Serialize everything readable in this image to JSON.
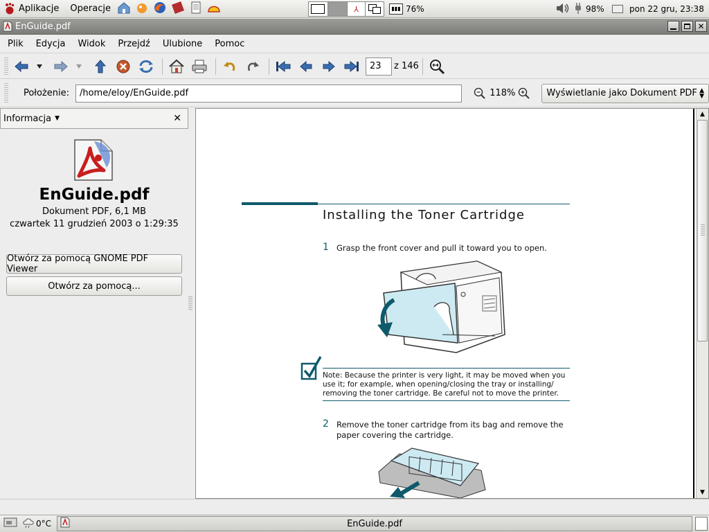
{
  "top_panel": {
    "menus": [
      "Aplikacje",
      "Operacje"
    ],
    "launchers": [
      "home-folder-icon",
      "gimp-icon",
      "firefox-icon",
      "dictionary-icon",
      "text-editor-icon",
      "shell-icon"
    ],
    "battery": "76%",
    "volume_icon": "speaker-icon",
    "power": "98%",
    "clock": "pon 22 gru, 23:38"
  },
  "window": {
    "title": "EnGuide.pdf"
  },
  "menubar": [
    "Plik",
    "Edycja",
    "Widok",
    "Przejdź",
    "Ulubione",
    "Pomoc"
  ],
  "toolbar": {
    "page_number": "23",
    "page_of": "z 146"
  },
  "location": {
    "label": "Położenie:",
    "path": "/home/eloy/EnGuide.pdf",
    "zoom": "118%",
    "view_as": "Wyświetlanie jako Dokument PDF"
  },
  "sidebar": {
    "header": "Informacja",
    "file_name": "EnGuide.pdf",
    "file_type": "Dokument PDF, 6,1 MB",
    "file_date": "czwartek 11 grudzień 2003 o 1:29:35",
    "open_with_default": "Otwórz za pomocą GNOME PDF Viewer",
    "open_with_other": "Otwórz za pomocą..."
  },
  "document": {
    "heading": "Installing the Toner Cartridge",
    "step1_number": "1",
    "step1_text": "Grasp the front cover and pull it toward you to open.",
    "note": "Note: Because the printer is very light, it may be moved when you use it; for example, when opening/closing the tray or installing/ removing the toner cartridge. Be careful not to move the printer.",
    "step2_number": "2",
    "step2_text": "Remove the toner cartridge from its bag and remove the paper covering the cartridge."
  },
  "bottom_panel": {
    "weather": "0°C",
    "task": "EnGuide.pdf"
  },
  "colors": {
    "teal": "#0e5a6b",
    "teal_light": "#cdeaf2"
  }
}
